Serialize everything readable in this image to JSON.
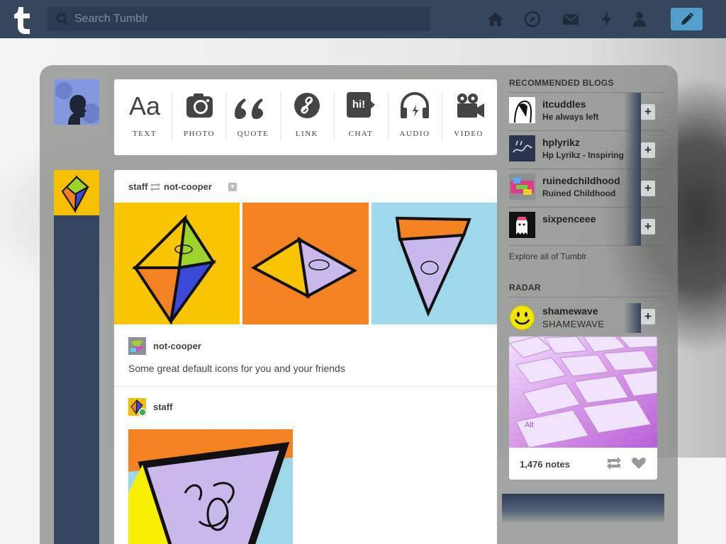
{
  "search": {
    "placeholder": "Search Tumblr"
  },
  "nav": {
    "icons": [
      "home-icon",
      "explore-icon",
      "inbox-icon",
      "activity-icon",
      "account-icon"
    ],
    "compose_icon": "pencil-icon"
  },
  "post_types": [
    {
      "label": "TEXT",
      "glyph": "Aa",
      "icon": "text-icon"
    },
    {
      "label": "PHOTO",
      "icon": "camera-icon"
    },
    {
      "label": "QUOTE",
      "glyph": "“",
      "icon": "quote-icon"
    },
    {
      "label": "LINK",
      "icon": "link-icon"
    },
    {
      "label": "CHAT",
      "glyph": "hi!",
      "icon": "chat-icon"
    },
    {
      "label": "AUDIO",
      "icon": "headphones-icon"
    },
    {
      "label": "VIDEO",
      "icon": "video-camera-icon"
    }
  ],
  "post": {
    "reblogger": "staff",
    "source": "not-cooper",
    "trail": [
      {
        "name": "not-cooper",
        "text": "Some great default icons for you and your friends"
      },
      {
        "name": "staff"
      }
    ]
  },
  "sidebar": {
    "recommended_heading": "RECOMMENDED BLOGS",
    "blogs": [
      {
        "name": "itcuddles",
        "desc": "He always left"
      },
      {
        "name": "hplyrikz",
        "desc": "Hp Lyrikz - Inspiring"
      },
      {
        "name": "ruinedchildhood",
        "desc": "Ruined Childhood"
      },
      {
        "name": "sixpenceee",
        "desc": ""
      }
    ],
    "follow_label": "+",
    "explore": "Explore all of Tumblr",
    "radar_heading": "RADAR",
    "radar": {
      "name": "shamewave",
      "desc": "SHAMEWAVE",
      "notes": "1,476 notes"
    }
  },
  "colors": {
    "nav_bg": "#36465d",
    "compose": "#529ecc",
    "accent_yellow": "#f5c000"
  }
}
